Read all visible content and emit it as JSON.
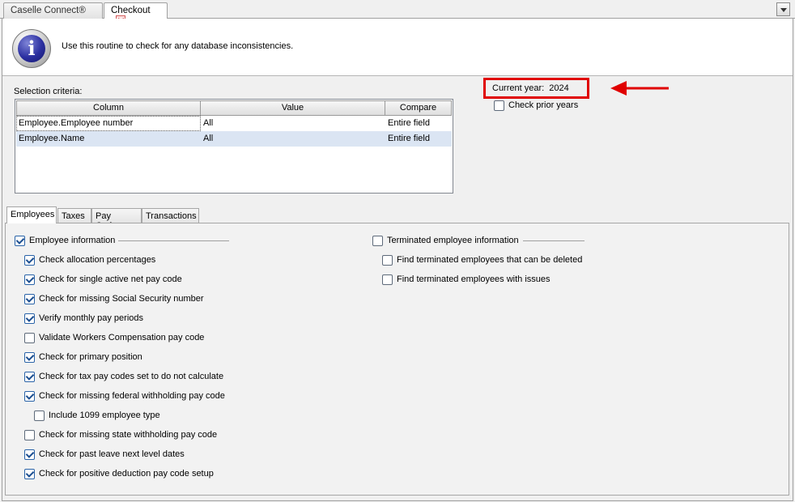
{
  "tabs": [
    {
      "label": "Caselle Connect®",
      "active": false
    },
    {
      "label": "Checkout",
      "active": true
    }
  ],
  "header": {
    "icon": "info-icon",
    "text": "Use this routine to check for any database inconsistencies."
  },
  "selection": {
    "label": "Selection criteria:",
    "columns": [
      "Column",
      "Value",
      "Compare"
    ],
    "rows": [
      [
        "Employee.Employee number",
        "All",
        "Entire field"
      ],
      [
        "Employee.Name",
        "All",
        "Entire field"
      ]
    ]
  },
  "current_year": {
    "label": "Current year:",
    "value": "2024",
    "highlight_color": "#e00000"
  },
  "check_prior_years": {
    "label": "Check prior years",
    "checked": false
  },
  "page_tabs": [
    "Employees",
    "Taxes",
    "Pay Codes",
    "Transactions"
  ],
  "employee_group": {
    "label": "Employee information",
    "checked": true,
    "items": [
      {
        "label": "Check allocation percentages",
        "checked": true
      },
      {
        "label": "Check for single active net pay code",
        "checked": true
      },
      {
        "label": "Check for missing Social Security number",
        "checked": true
      },
      {
        "label": "Verify monthly pay periods",
        "checked": true
      },
      {
        "label": "Validate Workers Compensation pay code",
        "checked": false
      },
      {
        "label": "Check for primary position",
        "checked": true
      },
      {
        "label": "Check for tax pay codes set to do not calculate",
        "checked": true
      },
      {
        "label": "Check for missing federal withholding pay code",
        "checked": true
      },
      {
        "label": "Include 1099 employee type",
        "checked": false
      },
      {
        "label": "Check for missing state withholding pay code",
        "checked": false
      },
      {
        "label": "Check for past leave next level dates",
        "checked": true
      },
      {
        "label": "Check for positive deduction pay code setup",
        "checked": true
      }
    ]
  },
  "terminated_group": {
    "label": "Terminated employee information",
    "checked": false,
    "items": [
      {
        "label": "Find terminated employees that can be deleted",
        "checked": false
      },
      {
        "label": "Find terminated employees with issues",
        "checked": false
      }
    ]
  }
}
